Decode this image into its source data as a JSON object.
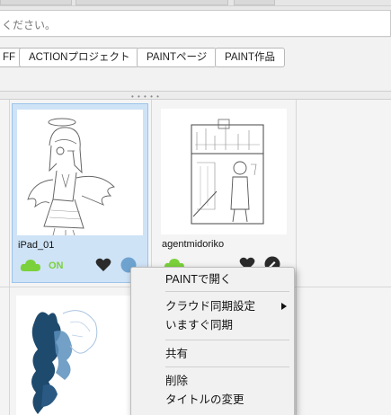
{
  "search": {
    "placeholder": "ください。"
  },
  "tags": [
    {
      "label": "FF"
    },
    {
      "label": "ACTIONプロジェクト"
    },
    {
      "label": "PAINTページ"
    },
    {
      "label": "PAINT作品"
    }
  ],
  "cards": [
    {
      "title": "iPad_01",
      "cloud_status": "ON",
      "selected": true
    },
    {
      "title": "agentmidoriko",
      "selected": false
    }
  ],
  "context_menu": {
    "items": [
      {
        "label": "PAINTで開く"
      },
      {
        "label": "クラウド同期設定",
        "has_submenu": true
      },
      {
        "label": "いますぐ同期"
      },
      {
        "label": "共有"
      },
      {
        "label": "削除"
      },
      {
        "label": "タイトルの変更"
      }
    ]
  },
  "colors": {
    "accent_green": "#7ad13b",
    "selection": "#cfe3f7",
    "icon_blue": "#6ea3d0"
  }
}
